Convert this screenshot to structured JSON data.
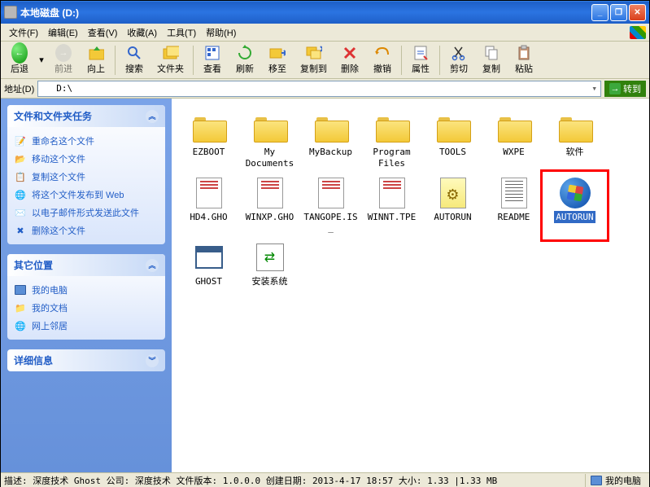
{
  "window": {
    "title": "本地磁盘 (D:)"
  },
  "menu": {
    "file": "文件(F)",
    "edit": "编辑(E)",
    "view": "查看(V)",
    "favorites": "收藏(A)",
    "tools": "工具(T)",
    "help": "帮助(H)"
  },
  "toolbar": {
    "back": "后退",
    "forward": "前进",
    "up": "向上",
    "search": "搜索",
    "folders": "文件夹",
    "view": "查看",
    "refresh": "刷新",
    "move_to": "移至",
    "copy_to": "复制到",
    "delete": "删除",
    "undo": "撤销",
    "properties": "属性",
    "cut": "剪切",
    "copy": "复制",
    "paste": "粘贴"
  },
  "addressbar": {
    "label": "地址(D)",
    "path": "D:\\",
    "go": "转到"
  },
  "sidebar": {
    "tasks_header": "文件和文件夹任务",
    "tasks": [
      "重命名这个文件",
      "移动这个文件",
      "复制这个文件",
      "将这个文件发布到 Web",
      "以电子邮件形式发送此文件",
      "删除这个文件"
    ],
    "places_header": "其它位置",
    "places": [
      "我的电脑",
      "我的文档",
      "网上邻居"
    ],
    "details_header": "详细信息"
  },
  "files": [
    {
      "name": "EZBOOT",
      "type": "folder"
    },
    {
      "name": "My Documents",
      "type": "folder"
    },
    {
      "name": "MyBackup",
      "type": "folder"
    },
    {
      "name": "Program Files",
      "type": "folder"
    },
    {
      "name": "TOOLS",
      "type": "folder"
    },
    {
      "name": "WXPE",
      "type": "folder"
    },
    {
      "name": "软件",
      "type": "folder"
    },
    {
      "name": "HD4.GHO",
      "type": "gho"
    },
    {
      "name": "WINXP.GHO",
      "type": "gho"
    },
    {
      "name": "TANGOPE.IS_",
      "type": "gho"
    },
    {
      "name": "WINNT.TPE",
      "type": "gho"
    },
    {
      "name": "AUTORUN",
      "type": "autorun"
    },
    {
      "name": "README",
      "type": "txt"
    },
    {
      "name": "AUTORUN",
      "type": "winlogo",
      "selected": true,
      "highlighted": true
    },
    {
      "name": "GHOST",
      "type": "exe"
    },
    {
      "name": "安装系统",
      "type": "setup"
    }
  ],
  "statusbar": {
    "description": "描述: 深度技术 Ghost 公司: 深度技术 文件版本: 1.0.0.0 创建日期: 2013-4-17 18:57 大小: 1.33 |1.33 MB",
    "location": "我的电脑"
  }
}
